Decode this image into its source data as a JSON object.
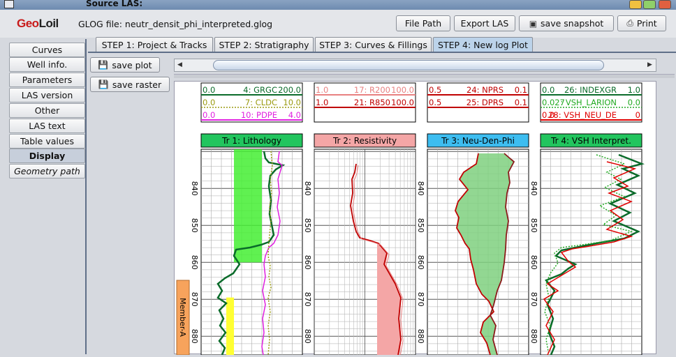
{
  "window": {
    "title": "Source LAS:"
  },
  "header": {
    "logo_a": "Geo",
    "logo_b": "Loil",
    "glog_file": "GLOG file: neutr_densit_phi_interpreted.glog",
    "buttons": {
      "file_path": "File Path",
      "export_las": "Export LAS",
      "save_snapshot": "save snapshot",
      "print": "Print"
    }
  },
  "sidebar": {
    "items": [
      {
        "label": "Curves"
      },
      {
        "label": "Well info."
      },
      {
        "label": "Parameters"
      },
      {
        "label": "LAS version"
      },
      {
        "label": "Other"
      },
      {
        "label": "LAS text"
      },
      {
        "label": "Table values"
      },
      {
        "label": "Display",
        "selected": true
      },
      {
        "label": "Geometry path"
      }
    ]
  },
  "tabs": [
    {
      "label": "STEP 1: Project & Tracks"
    },
    {
      "label": "STEP 2: Stratigraphy"
    },
    {
      "label": "STEP 3: Curves & Fillings"
    },
    {
      "label": "STEP 4: New log Plot",
      "selected": true
    }
  ],
  "actions": {
    "save_plot": "save plot",
    "save_raster": "save raster"
  },
  "plot": {
    "depth_labels": [
      "840",
      "850",
      "860",
      "870",
      "880"
    ],
    "member_label": "Member-A",
    "tracks": [
      {
        "title": "Tr 1: Lithology",
        "title_bg": "#22c55e",
        "curves": [
          {
            "min": "0.0",
            "name": "4: GRGC",
            "max": "200.0",
            "color": "#0a6b2a"
          },
          {
            "min": "0.0",
            "name": "7: CLDC",
            "max": "10.0",
            "color": "#9a9a10"
          },
          {
            "min": "0.0",
            "name": "10: PDPE",
            "max": "4.0",
            "color": "#e020e0"
          }
        ]
      },
      {
        "title": "Tr 2: Resistivity",
        "title_bg": "#f4a6a6",
        "curves": [
          {
            "min": "1.0",
            "name": "17: R200",
            "max": "100.0",
            "color": "#e88080"
          },
          {
            "min": "1.0",
            "name": "21: R850",
            "max": "100.0",
            "color": "#c00000"
          }
        ]
      },
      {
        "title": "Tr 3: Neu-Den-Phi",
        "title_bg": "#3dbdf0",
        "curves": [
          {
            "min": "0.5",
            "name": "24: NPRS",
            "max": "0.1",
            "color": "#c00000"
          },
          {
            "min": "0.5",
            "name": "25: DPRS",
            "max": "0.1",
            "color": "#c00000"
          }
        ]
      },
      {
        "title": "Tr 4: VSH Interpret.",
        "title_bg": "#22c55e",
        "curves": [
          {
            "min": "0.0",
            "name": "26: INDEXGR",
            "max": "1.0",
            "color": "#0a6b2a"
          },
          {
            "min": "0.027",
            "name": ": VSH_LARION",
            "max": "0.0",
            "color": "#22aa22"
          },
          {
            "min": "0.0",
            "name": "28: VSH_NEU_DE",
            "max": "0",
            "color": "#e00000"
          }
        ]
      }
    ]
  },
  "colors": {
    "accent": "#5f6f88",
    "selected_tab": "#bcd3ea",
    "fill_green": "#7fd07f",
    "fill_lime": "#44ee33",
    "fill_yellow": "#ffff33",
    "fill_pink": "#f4a6a6",
    "member_bg": "#f7a35c"
  }
}
